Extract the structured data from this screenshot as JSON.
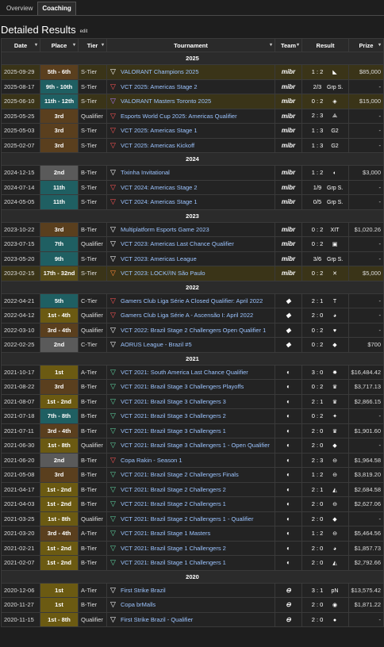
{
  "tabs": [
    "Overview",
    "Coaching"
  ],
  "title": "Detailed Results",
  "edit": "edit",
  "columns": [
    "Date",
    "Place",
    "Tier",
    "Tournament",
    "Team",
    "Result",
    "Prize"
  ],
  "years": [
    {
      "year": "2025",
      "rows": [
        {
          "date": "2025-09-29",
          "place": "5th - 6th",
          "pclass": "p3",
          "tier": "S-Tier",
          "icon": "ico-w",
          "tournament": "VALORANT Champions 2025",
          "team": "mibr",
          "score": "1 : 2",
          "opp": "◣",
          "prize": "$85,000",
          "hl": true
        },
        {
          "date": "2025-08-17",
          "place": "9th - 10th",
          "pclass": "pt",
          "tier": "S-Tier",
          "icon": "ico-r",
          "tournament": "VCT 2025: Americas Stage 2",
          "team": "mibr",
          "score": "2/3",
          "opp": "Grp S.",
          "prize": "-",
          "hl": false
        },
        {
          "date": "2025-06-10",
          "place": "11th - 12th",
          "pclass": "pt",
          "tier": "S-Tier",
          "icon": "ico-p",
          "tournament": "VALORANT Masters Toronto 2025",
          "team": "mibr",
          "score": "0 : 2",
          "opp": "◈",
          "prize": "$15,000",
          "hl": true
        },
        {
          "date": "2025-05-25",
          "place": "3rd",
          "pclass": "p3",
          "tier": "Qualifier",
          "icon": "ico-r",
          "tournament": "Esports World Cup 2025: Americas Qualifier",
          "team": "mibr",
          "score": "2 : 3",
          "opp": "⟁",
          "prize": "-",
          "hl": false
        },
        {
          "date": "2025-05-03",
          "place": "3rd",
          "pclass": "p3",
          "tier": "S-Tier",
          "icon": "ico-r",
          "tournament": "VCT 2025: Americas Stage 1",
          "team": "mibr",
          "score": "1 : 3",
          "opp": "G2",
          "prize": "-",
          "hl": false
        },
        {
          "date": "2025-02-07",
          "place": "3rd",
          "pclass": "p3",
          "tier": "S-Tier",
          "icon": "ico-r",
          "tournament": "VCT 2025: Americas Kickoff",
          "team": "mibr",
          "score": "1 : 3",
          "opp": "G2",
          "prize": "-",
          "hl": false
        }
      ]
    },
    {
      "year": "2024",
      "rows": [
        {
          "date": "2024-12-15",
          "place": "2nd",
          "pclass": "p2",
          "tier": "B-Tier",
          "icon": "ico-w",
          "tournament": "Tixinha Invitational",
          "team": "mibr",
          "score": "1 : 2",
          "opp": "◐",
          "prize": "$3,000",
          "hl": false
        },
        {
          "date": "2024-07-14",
          "place": "11th",
          "pclass": "pt",
          "tier": "S-Tier",
          "icon": "ico-r",
          "tournament": "VCT 2024: Americas Stage 2",
          "team": "mibr",
          "score": "1/9",
          "opp": "Grp S.",
          "prize": "-",
          "hl": false
        },
        {
          "date": "2024-05-05",
          "place": "11th",
          "pclass": "pt",
          "tier": "S-Tier",
          "icon": "ico-r",
          "tournament": "VCT 2024: Americas Stage 1",
          "team": "mibr",
          "score": "0/5",
          "opp": "Grp S.",
          "prize": "-",
          "hl": false
        }
      ]
    },
    {
      "year": "2023",
      "rows": [
        {
          "date": "2023-10-22",
          "place": "3rd",
          "pclass": "p3",
          "tier": "B-Tier",
          "icon": "ico-w",
          "tournament": "Multiplatform Esports Game 2023",
          "team": "mibr",
          "score": "0 : 2",
          "opp": "XIT",
          "prize": "$1,020.26",
          "hl": false
        },
        {
          "date": "2023-07-15",
          "place": "7th",
          "pclass": "pt",
          "tier": "Qualifier",
          "icon": "ico-w",
          "tournament": "VCT 2023: Americas Last Chance Qualifier",
          "team": "mibr",
          "score": "0 : 2",
          "opp": "▣",
          "prize": "-",
          "hl": false
        },
        {
          "date": "2023-05-20",
          "place": "9th",
          "pclass": "pt",
          "tier": "S-Tier",
          "icon": "ico-w",
          "tournament": "VCT 2023: Americas League",
          "team": "mibr",
          "score": "3/6",
          "opp": "Grp S.",
          "prize": "-",
          "hl": false
        },
        {
          "date": "2023-02-15",
          "place": "17th - 32nd",
          "pclass": "py",
          "tier": "S-Tier",
          "icon": "ico-o",
          "tournament": "VCT 2023: LOCK//IN São Paulo",
          "team": "mibr",
          "score": "0 : 2",
          "opp": "✕",
          "prize": "$5,000",
          "hl": true
        }
      ]
    },
    {
      "year": "2022",
      "rows": [
        {
          "date": "2022-04-21",
          "place": "5th",
          "pclass": "pt",
          "tier": "C-Tier",
          "icon": "ico-r",
          "tournament": "Gamers Club Liga Série A Closed Qualifier: April 2022",
          "team": "◆",
          "score": "2 : 1",
          "opp": "T",
          "prize": "-",
          "hl": false
        },
        {
          "date": "2022-04-12",
          "place": "1st - 4th",
          "pclass": "p1",
          "tier": "Qualifier",
          "icon": "ico-r",
          "tournament": "Gamers Club Liga Série A - Ascensão I: April 2022",
          "team": "◆",
          "score": "2 : 0",
          "opp": "◕",
          "prize": "-",
          "hl": false
        },
        {
          "date": "2022-03-10",
          "place": "3rd - 4th",
          "pclass": "p3",
          "tier": "Qualifier",
          "icon": "ico-w",
          "tournament": "VCT 2022: Brazil Stage 2 Challengers Open Qualifier 1",
          "team": "◆",
          "score": "0 : 2",
          "opp": "♥",
          "prize": "-",
          "hl": false
        },
        {
          "date": "2022-02-25",
          "place": "2nd",
          "pclass": "p2",
          "tier": "C-Tier",
          "icon": "ico-w",
          "tournament": "AORUS League - Brazil #5",
          "team": "◆",
          "score": "0 : 2",
          "opp": "◆",
          "prize": "$700",
          "hl": false
        }
      ]
    },
    {
      "year": "2021",
      "rows": [
        {
          "date": "2021-10-17",
          "place": "1st",
          "pclass": "p1",
          "tier": "A-Tier",
          "icon": "ico-g",
          "tournament": "VCT 2021: South America Last Chance Qualifier",
          "team": "◐",
          "score": "3 : 0",
          "opp": "✸",
          "prize": "$16,484.42",
          "hl": false
        },
        {
          "date": "2021-08-22",
          "place": "3rd",
          "pclass": "p3",
          "tier": "B-Tier",
          "icon": "ico-g",
          "tournament": "VCT 2021: Brazil Stage 3 Challengers Playoffs",
          "team": "◐",
          "score": "0 : 2",
          "opp": "♛",
          "prize": "$3,717.13",
          "hl": false
        },
        {
          "date": "2021-08-07",
          "place": "1st - 2nd",
          "pclass": "p1",
          "tier": "B-Tier",
          "icon": "ico-g",
          "tournament": "VCT 2021: Brazil Stage 3 Challengers 3",
          "team": "◐",
          "score": "2 : 1",
          "opp": "♛",
          "prize": "$2,866.15",
          "hl": false
        },
        {
          "date": "2021-07-18",
          "place": "7th - 8th",
          "pclass": "pt",
          "tier": "B-Tier",
          "icon": "ico-g",
          "tournament": "VCT 2021: Brazil Stage 3 Challengers 2",
          "team": "◐",
          "score": "0 : 2",
          "opp": "✦",
          "prize": "-",
          "hl": false
        },
        {
          "date": "2021-07-11",
          "place": "3rd - 4th",
          "pclass": "p3",
          "tier": "B-Tier",
          "icon": "ico-g",
          "tournament": "VCT 2021: Brazil Stage 3 Challengers 1",
          "team": "◐",
          "score": "2 : 0",
          "opp": "♛",
          "prize": "$1,901.60",
          "hl": false
        },
        {
          "date": "2021-06-30",
          "place": "1st - 8th",
          "pclass": "p1",
          "tier": "Qualifier",
          "icon": "ico-g",
          "tournament": "VCT 2021: Brazil Stage 3 Challengers 1 - Open Qualifier",
          "team": "◐",
          "score": "2 : 0",
          "opp": "◆",
          "prize": "-",
          "hl": false
        },
        {
          "date": "2021-06-20",
          "place": "2nd",
          "pclass": "p2",
          "tier": "B-Tier",
          "icon": "ico-r",
          "tournament": "Copa Rakin - Season 1",
          "team": "◐",
          "score": "2 : 3",
          "opp": "⊖",
          "prize": "$1,964.58",
          "hl": false
        },
        {
          "date": "2021-05-08",
          "place": "3rd",
          "pclass": "p3",
          "tier": "B-Tier",
          "icon": "ico-g",
          "tournament": "VCT 2021: Brazil Stage 2 Challengers Finals",
          "team": "◐",
          "score": "1 : 2",
          "opp": "⊖",
          "prize": "$3,819.20",
          "hl": false
        },
        {
          "date": "2021-04-17",
          "place": "1st - 2nd",
          "pclass": "p1",
          "tier": "B-Tier",
          "icon": "ico-g",
          "tournament": "VCT 2021: Brazil Stage 2 Challengers 2",
          "team": "◐",
          "score": "2 : 1",
          "opp": "◭",
          "prize": "$2,684.58",
          "hl": false
        },
        {
          "date": "2021-04-03",
          "place": "1st - 2nd",
          "pclass": "p1",
          "tier": "B-Tier",
          "icon": "ico-g",
          "tournament": "VCT 2021: Brazil Stage 2 Challengers 1",
          "team": "◐",
          "score": "2 : 0",
          "opp": "⊖",
          "prize": "$2,627.06",
          "hl": false
        },
        {
          "date": "2021-03-25",
          "place": "1st - 8th",
          "pclass": "p1",
          "tier": "Qualifier",
          "icon": "ico-g",
          "tournament": "VCT 2021: Brazil Stage 2 Challengers 1 - Qualifier",
          "team": "◐",
          "score": "2 : 0",
          "opp": "◆",
          "prize": "-",
          "hl": false
        },
        {
          "date": "2021-03-20",
          "place": "3rd - 4th",
          "pclass": "p3",
          "tier": "A-Tier",
          "icon": "ico-g",
          "tournament": "VCT 2021: Brazil Stage 1 Masters",
          "team": "◐",
          "score": "1 : 2",
          "opp": "⊖",
          "prize": "$5,464.56",
          "hl": false
        },
        {
          "date": "2021-02-21",
          "place": "1st - 2nd",
          "pclass": "p1",
          "tier": "B-Tier",
          "icon": "ico-g",
          "tournament": "VCT 2021: Brazil Stage 1 Challengers 2",
          "team": "◐",
          "score": "2 : 0",
          "opp": "◕",
          "prize": "$1,857.73",
          "hl": false
        },
        {
          "date": "2021-02-07",
          "place": "1st - 2nd",
          "pclass": "p1",
          "tier": "B-Tier",
          "icon": "ico-g",
          "tournament": "VCT 2021: Brazil Stage 1 Challengers 1",
          "team": "◐",
          "score": "2 : 0",
          "opp": "◭",
          "prize": "$2,792.66",
          "hl": false
        }
      ]
    },
    {
      "year": "2020",
      "rows": [
        {
          "date": "2020-12-06",
          "place": "1st",
          "pclass": "p1",
          "tier": "A-Tier",
          "icon": "ico-w",
          "tournament": "First Strike Brazil",
          "team": "⊖",
          "score": "3 : 1",
          "opp": "pN",
          "prize": "$13,575.42",
          "hl": false
        },
        {
          "date": "2020-11-27",
          "place": "1st",
          "pclass": "p1",
          "tier": "B-Tier",
          "icon": "ico-w",
          "tournament": "Copa brMalls",
          "team": "⊖",
          "score": "2 : 0",
          "opp": "◉",
          "prize": "$1,871.22",
          "hl": false
        },
        {
          "date": "2020-11-15",
          "place": "1st - 8th",
          "pclass": "p1",
          "tier": "Qualifier",
          "icon": "ico-w",
          "tournament": "First Strike Brazil - Qualifier",
          "team": "⊖",
          "score": "2 : 0",
          "opp": "●",
          "prize": "-",
          "hl": false
        }
      ]
    }
  ]
}
